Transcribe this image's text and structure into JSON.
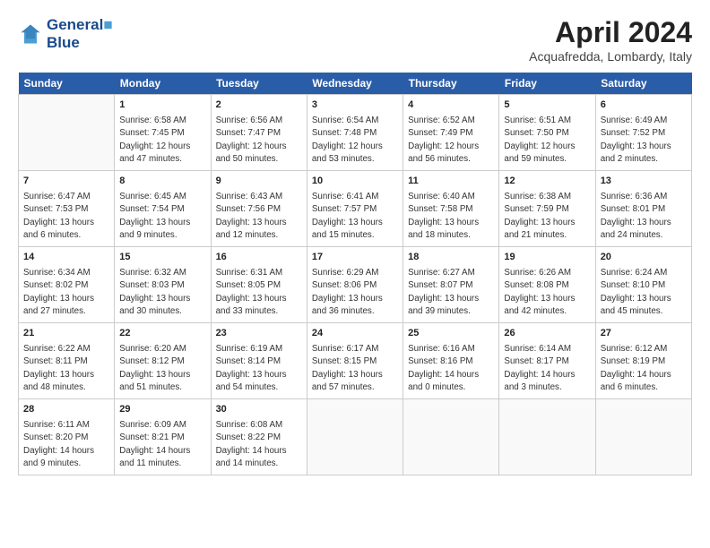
{
  "header": {
    "logo_line1": "General",
    "logo_line2": "Blue",
    "month_title": "April 2024",
    "location": "Acquafredda, Lombardy, Italy"
  },
  "weekdays": [
    "Sunday",
    "Monday",
    "Tuesday",
    "Wednesday",
    "Thursday",
    "Friday",
    "Saturday"
  ],
  "weeks": [
    [
      {
        "day": "",
        "sunrise": "",
        "sunset": "",
        "daylight": ""
      },
      {
        "day": "1",
        "sunrise": "Sunrise: 6:58 AM",
        "sunset": "Sunset: 7:45 PM",
        "daylight": "Daylight: 12 hours and 47 minutes."
      },
      {
        "day": "2",
        "sunrise": "Sunrise: 6:56 AM",
        "sunset": "Sunset: 7:47 PM",
        "daylight": "Daylight: 12 hours and 50 minutes."
      },
      {
        "day": "3",
        "sunrise": "Sunrise: 6:54 AM",
        "sunset": "Sunset: 7:48 PM",
        "daylight": "Daylight: 12 hours and 53 minutes."
      },
      {
        "day": "4",
        "sunrise": "Sunrise: 6:52 AM",
        "sunset": "Sunset: 7:49 PM",
        "daylight": "Daylight: 12 hours and 56 minutes."
      },
      {
        "day": "5",
        "sunrise": "Sunrise: 6:51 AM",
        "sunset": "Sunset: 7:50 PM",
        "daylight": "Daylight: 12 hours and 59 minutes."
      },
      {
        "day": "6",
        "sunrise": "Sunrise: 6:49 AM",
        "sunset": "Sunset: 7:52 PM",
        "daylight": "Daylight: 13 hours and 2 minutes."
      }
    ],
    [
      {
        "day": "7",
        "sunrise": "Sunrise: 6:47 AM",
        "sunset": "Sunset: 7:53 PM",
        "daylight": "Daylight: 13 hours and 6 minutes."
      },
      {
        "day": "8",
        "sunrise": "Sunrise: 6:45 AM",
        "sunset": "Sunset: 7:54 PM",
        "daylight": "Daylight: 13 hours and 9 minutes."
      },
      {
        "day": "9",
        "sunrise": "Sunrise: 6:43 AM",
        "sunset": "Sunset: 7:56 PM",
        "daylight": "Daylight: 13 hours and 12 minutes."
      },
      {
        "day": "10",
        "sunrise": "Sunrise: 6:41 AM",
        "sunset": "Sunset: 7:57 PM",
        "daylight": "Daylight: 13 hours and 15 minutes."
      },
      {
        "day": "11",
        "sunrise": "Sunrise: 6:40 AM",
        "sunset": "Sunset: 7:58 PM",
        "daylight": "Daylight: 13 hours and 18 minutes."
      },
      {
        "day": "12",
        "sunrise": "Sunrise: 6:38 AM",
        "sunset": "Sunset: 7:59 PM",
        "daylight": "Daylight: 13 hours and 21 minutes."
      },
      {
        "day": "13",
        "sunrise": "Sunrise: 6:36 AM",
        "sunset": "Sunset: 8:01 PM",
        "daylight": "Daylight: 13 hours and 24 minutes."
      }
    ],
    [
      {
        "day": "14",
        "sunrise": "Sunrise: 6:34 AM",
        "sunset": "Sunset: 8:02 PM",
        "daylight": "Daylight: 13 hours and 27 minutes."
      },
      {
        "day": "15",
        "sunrise": "Sunrise: 6:32 AM",
        "sunset": "Sunset: 8:03 PM",
        "daylight": "Daylight: 13 hours and 30 minutes."
      },
      {
        "day": "16",
        "sunrise": "Sunrise: 6:31 AM",
        "sunset": "Sunset: 8:05 PM",
        "daylight": "Daylight: 13 hours and 33 minutes."
      },
      {
        "day": "17",
        "sunrise": "Sunrise: 6:29 AM",
        "sunset": "Sunset: 8:06 PM",
        "daylight": "Daylight: 13 hours and 36 minutes."
      },
      {
        "day": "18",
        "sunrise": "Sunrise: 6:27 AM",
        "sunset": "Sunset: 8:07 PM",
        "daylight": "Daylight: 13 hours and 39 minutes."
      },
      {
        "day": "19",
        "sunrise": "Sunrise: 6:26 AM",
        "sunset": "Sunset: 8:08 PM",
        "daylight": "Daylight: 13 hours and 42 minutes."
      },
      {
        "day": "20",
        "sunrise": "Sunrise: 6:24 AM",
        "sunset": "Sunset: 8:10 PM",
        "daylight": "Daylight: 13 hours and 45 minutes."
      }
    ],
    [
      {
        "day": "21",
        "sunrise": "Sunrise: 6:22 AM",
        "sunset": "Sunset: 8:11 PM",
        "daylight": "Daylight: 13 hours and 48 minutes."
      },
      {
        "day": "22",
        "sunrise": "Sunrise: 6:20 AM",
        "sunset": "Sunset: 8:12 PM",
        "daylight": "Daylight: 13 hours and 51 minutes."
      },
      {
        "day": "23",
        "sunrise": "Sunrise: 6:19 AM",
        "sunset": "Sunset: 8:14 PM",
        "daylight": "Daylight: 13 hours and 54 minutes."
      },
      {
        "day": "24",
        "sunrise": "Sunrise: 6:17 AM",
        "sunset": "Sunset: 8:15 PM",
        "daylight": "Daylight: 13 hours and 57 minutes."
      },
      {
        "day": "25",
        "sunrise": "Sunrise: 6:16 AM",
        "sunset": "Sunset: 8:16 PM",
        "daylight": "Daylight: 14 hours and 0 minutes."
      },
      {
        "day": "26",
        "sunrise": "Sunrise: 6:14 AM",
        "sunset": "Sunset: 8:17 PM",
        "daylight": "Daylight: 14 hours and 3 minutes."
      },
      {
        "day": "27",
        "sunrise": "Sunrise: 6:12 AM",
        "sunset": "Sunset: 8:19 PM",
        "daylight": "Daylight: 14 hours and 6 minutes."
      }
    ],
    [
      {
        "day": "28",
        "sunrise": "Sunrise: 6:11 AM",
        "sunset": "Sunset: 8:20 PM",
        "daylight": "Daylight: 14 hours and 9 minutes."
      },
      {
        "day": "29",
        "sunrise": "Sunrise: 6:09 AM",
        "sunset": "Sunset: 8:21 PM",
        "daylight": "Daylight: 14 hours and 11 minutes."
      },
      {
        "day": "30",
        "sunrise": "Sunrise: 6:08 AM",
        "sunset": "Sunset: 8:22 PM",
        "daylight": "Daylight: 14 hours and 14 minutes."
      },
      {
        "day": "",
        "sunrise": "",
        "sunset": "",
        "daylight": ""
      },
      {
        "day": "",
        "sunrise": "",
        "sunset": "",
        "daylight": ""
      },
      {
        "day": "",
        "sunrise": "",
        "sunset": "",
        "daylight": ""
      },
      {
        "day": "",
        "sunrise": "",
        "sunset": "",
        "daylight": ""
      }
    ]
  ]
}
